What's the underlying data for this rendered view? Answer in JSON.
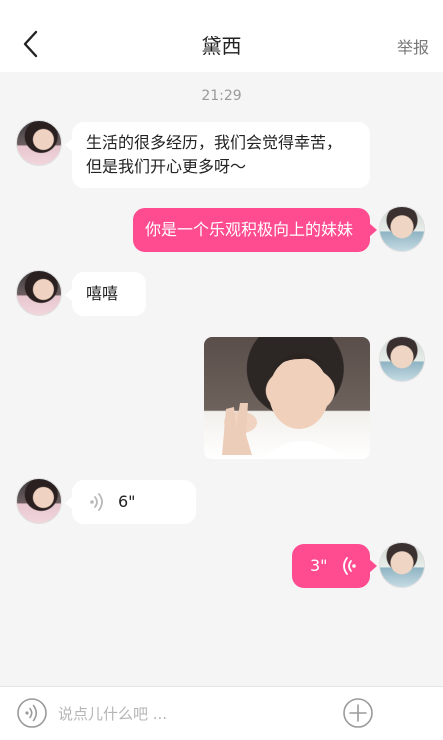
{
  "header": {
    "title": "黛西",
    "report_label": "举报",
    "back_icon": "chevron-left-icon"
  },
  "chat": {
    "time_label": "21:29",
    "messages": [
      {
        "side": "in",
        "type": "text",
        "lines": [
          "生活的很多经历，我们会觉得幸苦，",
          "但是我们开心更多呀～"
        ]
      },
      {
        "side": "out",
        "type": "text",
        "text": "你是一个乐观积极向上的妹妹"
      },
      {
        "side": "in",
        "type": "text",
        "text": "嘻嘻"
      },
      {
        "side": "out",
        "type": "image"
      },
      {
        "side": "in",
        "type": "voice",
        "duration": "6\""
      },
      {
        "side": "out",
        "type": "voice",
        "duration": "3\""
      }
    ]
  },
  "input": {
    "placeholder": "说点儿什么吧 ...",
    "value": "",
    "voice_icon": "voice-toggle-icon",
    "plus_icon": "plus-icon"
  },
  "colors": {
    "accent": "#ff4b8f",
    "background": "#f5f5f5",
    "bubble_in": "#ffffff"
  }
}
